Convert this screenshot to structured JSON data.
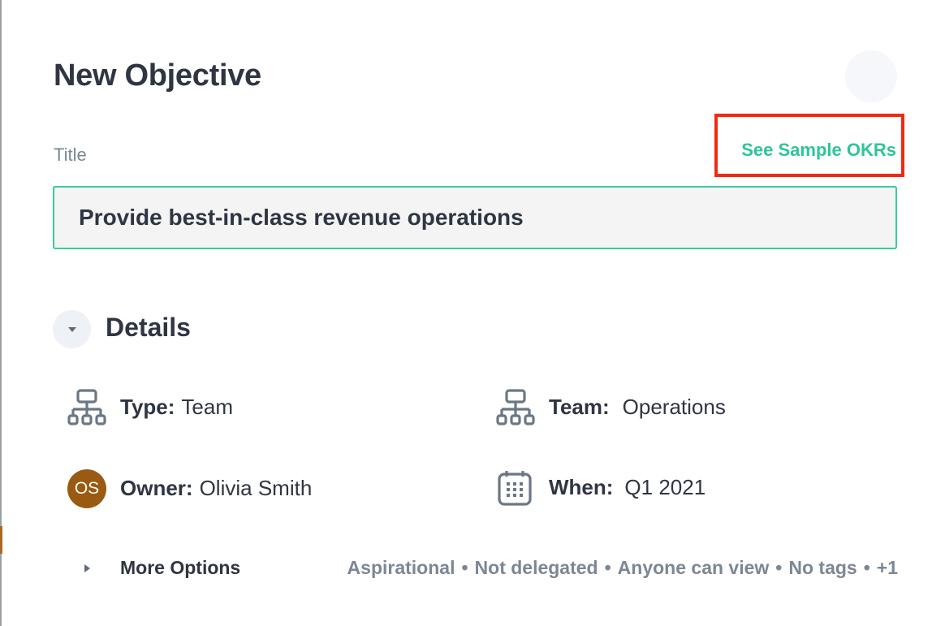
{
  "header": {
    "title": "New Objective"
  },
  "form": {
    "title_label": "Title",
    "sample_link": "See Sample OKRs",
    "title_value": "Provide best-in-class revenue operations"
  },
  "details": {
    "heading": "Details",
    "type": {
      "label": "Type:",
      "value": "Team"
    },
    "team": {
      "label": "Team:",
      "value": "Operations"
    },
    "owner": {
      "label": "Owner:",
      "value": "Olivia Smith",
      "initials": "OS"
    },
    "when": {
      "label": "When:",
      "value": "Q1 2021"
    }
  },
  "more_options": {
    "label": "More Options",
    "summary": [
      "Aspirational",
      "Not delegated",
      "Anyone can view",
      "No tags",
      "+1"
    ],
    "separator": "•"
  },
  "colors": {
    "accent": "#2ec49a",
    "highlight": "#f02a10",
    "avatar": "#9a5a12",
    "text": "#2f3542",
    "muted": "#7c8794"
  },
  "icons": {
    "type": "hierarchy-icon",
    "team": "hierarchy-icon",
    "when": "calendar-icon",
    "details_toggle": "caret-down-icon",
    "more_toggle": "caret-right-icon"
  }
}
